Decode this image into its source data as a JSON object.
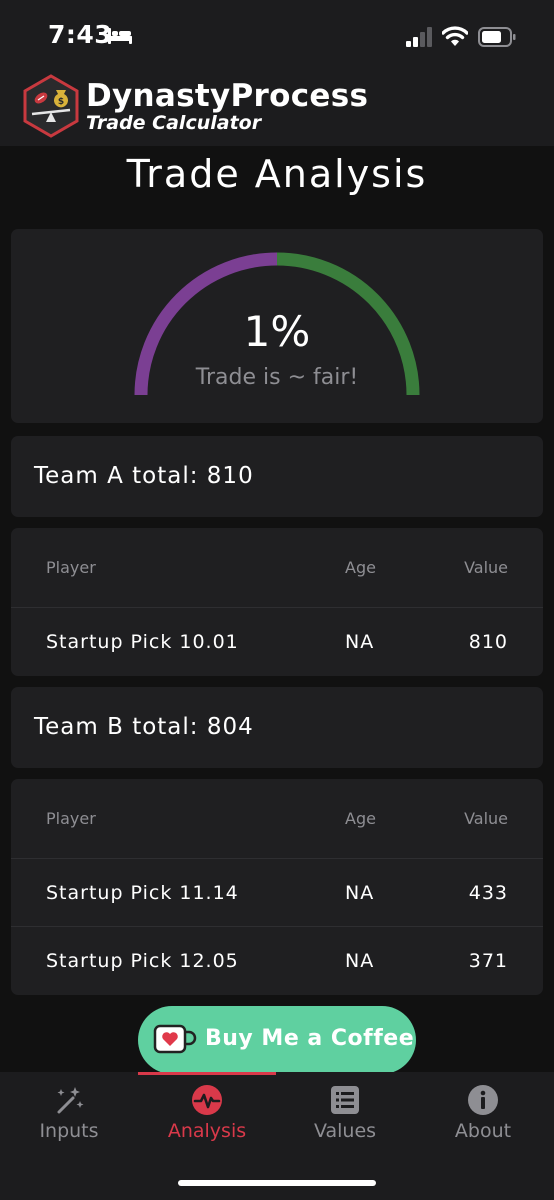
{
  "status_bar": {
    "time": "7:43"
  },
  "header": {
    "brand_name": "DynastyProcess",
    "brand_sub": "Trade Calculator"
  },
  "page": {
    "title": "Trade Analysis"
  },
  "gauge": {
    "percent_text": "1%",
    "label": "Trade is ~ fair!",
    "value_percent": 1,
    "color_a": "#7b3f93",
    "color_b": "#3a7d3c"
  },
  "team_a": {
    "total_label": "Team A total: 810",
    "columns": [
      "Player",
      "Age",
      "Value"
    ],
    "rows": [
      {
        "player": "Startup Pick 10.01",
        "age": "NA",
        "value": "810"
      }
    ]
  },
  "team_b": {
    "total_label": "Team B total: 804",
    "columns": [
      "Player",
      "Age",
      "Value"
    ],
    "rows": [
      {
        "player": "Startup Pick 11.14",
        "age": "NA",
        "value": "433"
      },
      {
        "player": "Startup Pick 12.05",
        "age": "NA",
        "value": "371"
      }
    ]
  },
  "coffee_button": {
    "label": "Buy Me a Coffee"
  },
  "tabs": [
    {
      "label": "Inputs",
      "icon": "magic-wand-icon",
      "active": false
    },
    {
      "label": "Analysis",
      "icon": "pulse-icon",
      "active": true
    },
    {
      "label": "Values",
      "icon": "list-icon",
      "active": false
    },
    {
      "label": "About",
      "icon": "info-icon",
      "active": false
    }
  ],
  "colors": {
    "accent": "#d9394a",
    "coffee": "#5fd0a0",
    "card": "#1f1f21",
    "background": "#111111"
  }
}
